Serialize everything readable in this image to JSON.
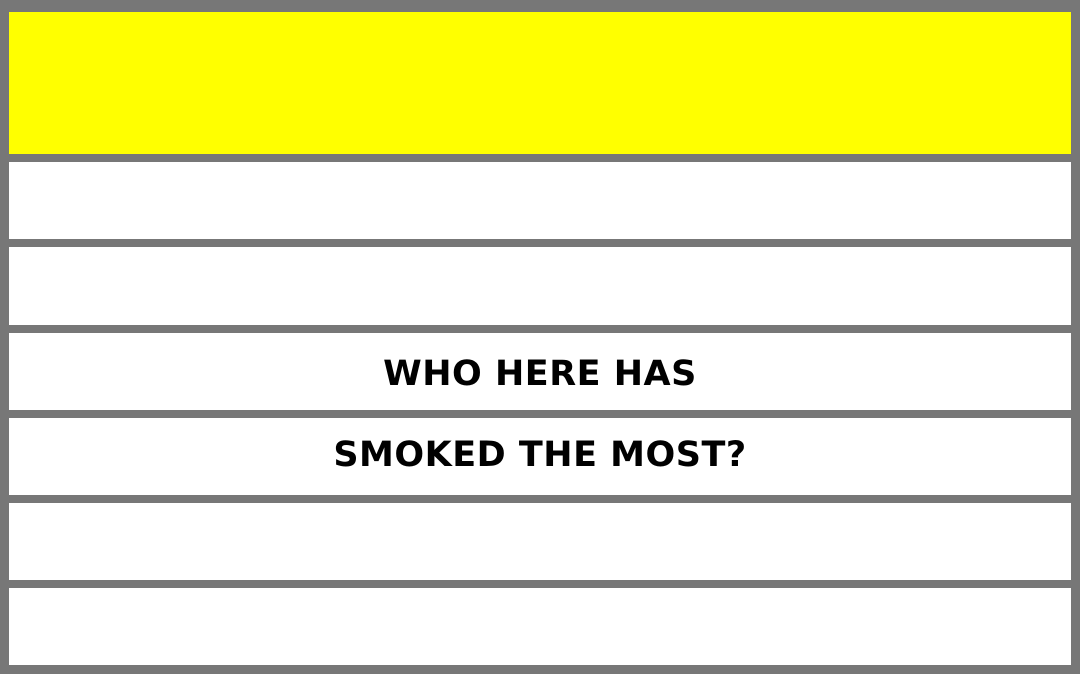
{
  "header": {
    "color": "#ffff00"
  },
  "rows": [
    {
      "text": ""
    },
    {
      "text": ""
    },
    {
      "text": "WHO HERE HAS"
    },
    {
      "text": "SMOKED THE MOST?"
    },
    {
      "text": ""
    },
    {
      "text": ""
    }
  ],
  "colors": {
    "border": "#777777",
    "row_fill": "#ffffff",
    "text": "#000000"
  }
}
